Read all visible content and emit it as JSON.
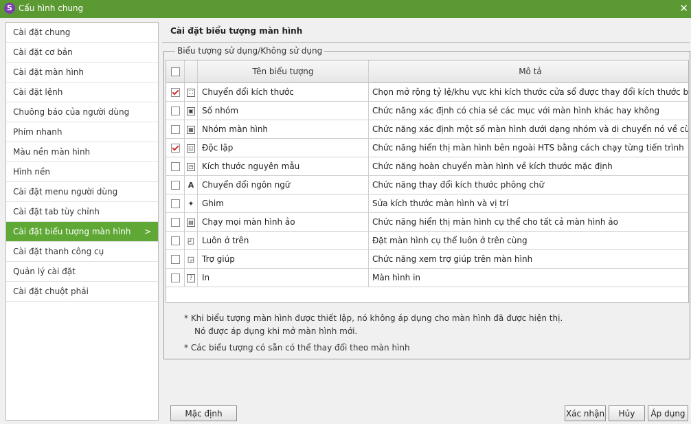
{
  "window": {
    "title": "Cấu hình chung",
    "close_symbol": "✕"
  },
  "sidebar": {
    "items": [
      {
        "label": "Cài đặt chung"
      },
      {
        "label": "Cài đặt cơ bản"
      },
      {
        "label": "Cài đặt màn hình"
      },
      {
        "label": "Cài đặt lệnh"
      },
      {
        "label": "Chuông báo của người dùng"
      },
      {
        "label": "Phím nhanh"
      },
      {
        "label": "Màu nền màn hình"
      },
      {
        "label": "Hình nền"
      },
      {
        "label": "Cài đặt menu người dùng"
      },
      {
        "label": "Cài đặt tab tùy chỉnh"
      },
      {
        "label": "Cài đặt biểu tượng màn hình",
        "active": true
      },
      {
        "label": "Cài đặt thanh công cụ"
      },
      {
        "label": "Quản lý cài đặt"
      },
      {
        "label": "Cài đặt chuột phải"
      }
    ],
    "chevron": ">"
  },
  "main": {
    "title": "Cài đặt biểu tượng màn hình",
    "group_label": "Biểu tượng sử dụng/Không sử dụng",
    "table": {
      "headers": {
        "name": "Tên biểu tượng",
        "desc": "Mô tả"
      },
      "rows": [
        {
          "checked": true,
          "icon": "⛶",
          "name": "Chuyển đổi kích thước",
          "desc": "Chọn mở rộng tỷ lệ/khu vực khi kích thước cửa sổ được thay đổi kích thước bằng"
        },
        {
          "checked": false,
          "icon": "▣",
          "name": "Số nhóm",
          "desc": "Chức năng xác định có chia sẻ các mục với màn hình khác hay không"
        },
        {
          "checked": false,
          "icon": "▦",
          "name": "Nhóm màn hình",
          "desc": "Chức năng xác định một số màn hình dưới dạng nhóm và di chuyển nó về cùng r"
        },
        {
          "checked": true,
          "icon": "◱",
          "name": "Độc lập",
          "desc": "Chức năng hiển thị màn hình bên ngoài HTS bằng cách chạy từng tiến trình"
        },
        {
          "checked": false,
          "icon": "◳",
          "name": "Kích thước nguyên mẫu",
          "desc": "Chức năng hoàn chuyển màn hình về kích thước mặc định"
        },
        {
          "checked": false,
          "icon": "A",
          "name": "Chuyển đổi ngôn ngữ",
          "desc": "Chức năng thay đổi kích thước phông chữ"
        },
        {
          "checked": false,
          "icon": "✦",
          "name": "Ghim",
          "desc": "Sửa kích thước màn hình và vị trí"
        },
        {
          "checked": false,
          "icon": "▤",
          "name": "Chạy mọi màn hình ảo",
          "desc": "Chức năng hiển thị màn hình cụ thể cho tất cả màn hình ảo"
        },
        {
          "checked": false,
          "icon": "◰",
          "name": "Luôn ở trên",
          "desc": "Đặt màn hình cụ thể luôn ở trên cùng"
        },
        {
          "checked": false,
          "icon": "◲",
          "name": "Trợ giúp",
          "desc": "Chức năng xem trợ giúp trên màn hình"
        },
        {
          "checked": false,
          "icon": "?",
          "name": "In",
          "desc": "Màn hình in"
        }
      ]
    },
    "notes": {
      "line1": "* Khi biểu tượng màn hình được thiết lập, nó không áp dụng cho màn hình đã được hiện thị.",
      "line2": "Nó được áp dụng khi mở màn hình mới.",
      "line3": "* Các biểu tượng có sẵn có thể thay đổi theo màn hình"
    }
  },
  "buttons": {
    "default": "Mặc định",
    "confirm": "Xác nhận",
    "cancel": "Hủy",
    "apply": "Áp dụng"
  },
  "colors": {
    "titlebar": "#5b9a32",
    "active_item": "#5fa836",
    "check_mark": "#d23030"
  }
}
